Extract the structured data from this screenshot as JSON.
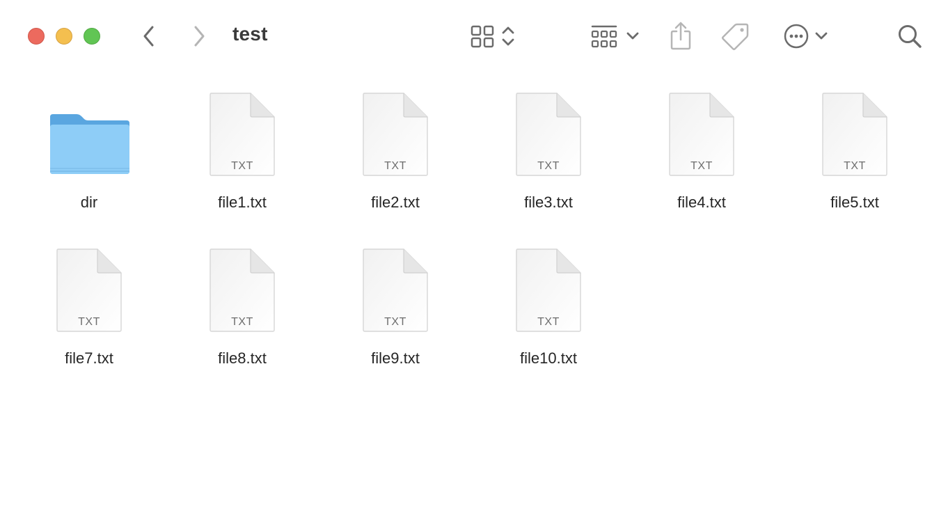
{
  "window": {
    "title": "test",
    "traffic_lights": {
      "close_color": "#ec6a5e",
      "minimize_color": "#f4bf4f",
      "maximize_color": "#61c554"
    }
  },
  "toolbar": {
    "back_icon": "chevron-left-icon",
    "forward_icon": "chevron-right-icon",
    "view_icon": "grid-view-icon",
    "group_icon": "group-by-icon",
    "share_icon": "share-icon",
    "tag_icon": "tag-icon",
    "more_icon": "ellipsis-circle-icon",
    "search_icon": "search-icon"
  },
  "items": [
    {
      "name": "dir",
      "kind": "folder"
    },
    {
      "name": "file1.txt",
      "kind": "txt",
      "badge": "TXT"
    },
    {
      "name": "file2.txt",
      "kind": "txt",
      "badge": "TXT"
    },
    {
      "name": "file3.txt",
      "kind": "txt",
      "badge": "TXT"
    },
    {
      "name": "file4.txt",
      "kind": "txt",
      "badge": "TXT"
    },
    {
      "name": "file5.txt",
      "kind": "txt",
      "badge": "TXT"
    },
    {
      "name": "file7.txt",
      "kind": "txt",
      "badge": "TXT"
    },
    {
      "name": "file8.txt",
      "kind": "txt",
      "badge": "TXT"
    },
    {
      "name": "file9.txt",
      "kind": "txt",
      "badge": "TXT"
    },
    {
      "name": "file10.txt",
      "kind": "txt",
      "badge": "TXT"
    }
  ],
  "colors": {
    "folder_front": "#8ecdf7",
    "folder_back": "#5aa6e0",
    "toolbar_icon": "#6b6b6b",
    "toolbar_icon_disabled": "#b5b5b5"
  }
}
